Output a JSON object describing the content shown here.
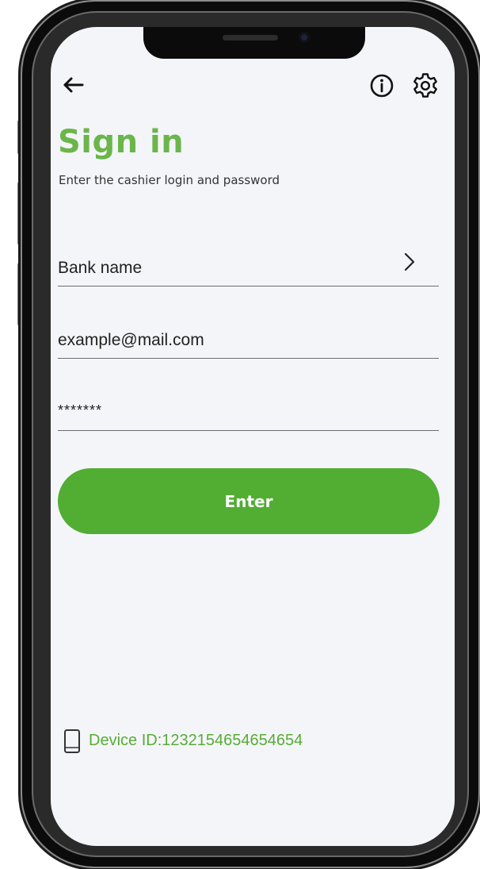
{
  "header": {
    "back_icon": "arrow-left-icon",
    "info_icon": "info-icon",
    "settings_icon": "gear-icon"
  },
  "signin": {
    "title": "Sign in",
    "subtitle": "Enter the cashier login and password"
  },
  "form": {
    "bank_name": "Bank name",
    "email": "example@mail.com",
    "password": "*******",
    "enter_label": "Enter"
  },
  "footer": {
    "device_id": "Device ID:1232154654654654",
    "device_icon": "phone-icon"
  },
  "colors": {
    "accent": "#6bb64a",
    "button": "#52ad33",
    "screen_bg": "#f4f5f9",
    "frame": "#0b0b0b"
  }
}
